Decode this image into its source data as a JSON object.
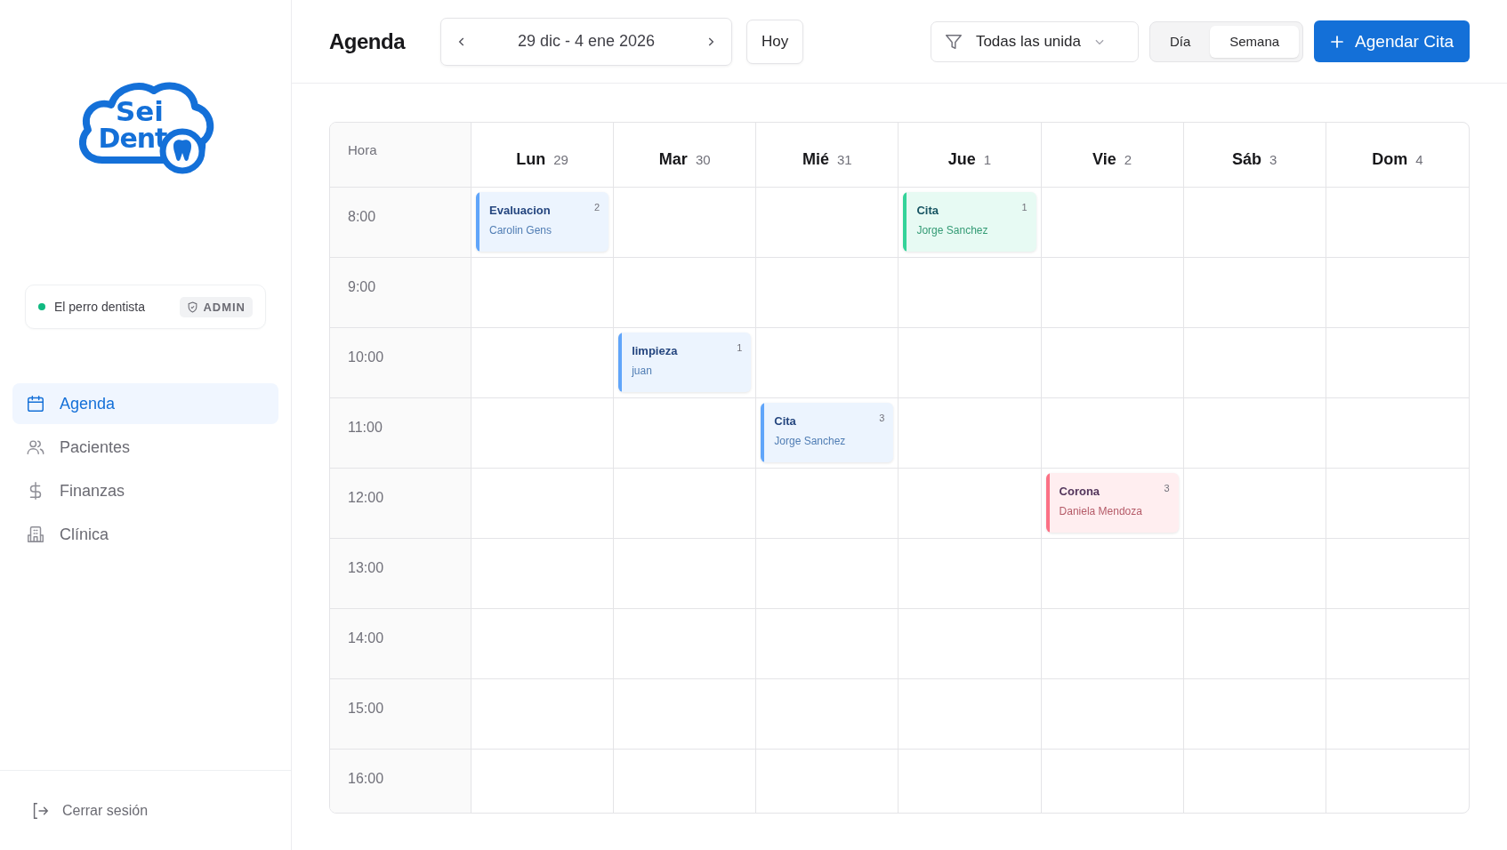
{
  "logo": {
    "line1": "Sei",
    "line2": "Dent"
  },
  "user": {
    "name": "El perro dentista",
    "online": true,
    "role": "ADMIN"
  },
  "nav": [
    {
      "label": "Agenda",
      "selected": true
    },
    {
      "label": "Pacientes",
      "selected": false
    },
    {
      "label": "Finanzas",
      "selected": false
    },
    {
      "label": "Clínica",
      "selected": false
    }
  ],
  "logout": "Cerrar sesión",
  "header": {
    "title": "Agenda",
    "range": "29 dic - 4 ene 2026",
    "today": "Hoy",
    "filter": "Todas las unida",
    "views": [
      {
        "label": "Día",
        "selected": false
      },
      {
        "label": "Semana",
        "selected": true
      }
    ],
    "new_button": "Agendar Cita"
  },
  "calendar": {
    "corner": "Hora",
    "days": [
      {
        "name": "Lun",
        "date": "29"
      },
      {
        "name": "Mar",
        "date": "30"
      },
      {
        "name": "Mié",
        "date": "31"
      },
      {
        "name": "Jue",
        "date": "1"
      },
      {
        "name": "Vie",
        "date": "2"
      },
      {
        "name": "Sáb",
        "date": "3"
      },
      {
        "name": "Dom",
        "date": "4"
      }
    ],
    "rows": [
      {
        "time": "8:00",
        "cells": [
          {
            "title": "Evaluacion",
            "patient": "Carolin Gens",
            "count": "2",
            "color": "#60a5fa"
          },
          null,
          null,
          {
            "title": "Cita",
            "patient": "Jorge Sanchez",
            "count": "1",
            "color": "#34d399"
          },
          null,
          null,
          null
        ]
      },
      {
        "time": "9:00",
        "cells": [
          null,
          null,
          null,
          null,
          null,
          null,
          null
        ]
      },
      {
        "time": "10:00",
        "cells": [
          null,
          {
            "title": "limpieza",
            "patient": "juan",
            "count": "1",
            "color": "#60a5fa"
          },
          null,
          null,
          null,
          null,
          null
        ]
      },
      {
        "time": "11:00",
        "cells": [
          null,
          null,
          {
            "title": "Cita",
            "patient": "Jorge Sanchez",
            "count": "3",
            "color": "#60a5fa"
          },
          null,
          null,
          null,
          null
        ]
      },
      {
        "time": "12:00",
        "cells": [
          null,
          null,
          null,
          null,
          {
            "title": "Corona",
            "patient": "Daniela Mendoza",
            "count": "3",
            "color": "#fb7185"
          },
          null,
          null
        ]
      },
      {
        "time": "13:00",
        "cells": [
          null,
          null,
          null,
          null,
          null,
          null,
          null
        ]
      },
      {
        "time": "14:00",
        "cells": [
          null,
          null,
          null,
          null,
          null,
          null,
          null
        ]
      },
      {
        "time": "15:00",
        "cells": [
          null,
          null,
          null,
          null,
          null,
          null,
          null
        ]
      },
      {
        "time": "16:00",
        "cells": [
          null,
          null,
          null,
          null,
          null,
          null,
          null
        ]
      }
    ]
  }
}
